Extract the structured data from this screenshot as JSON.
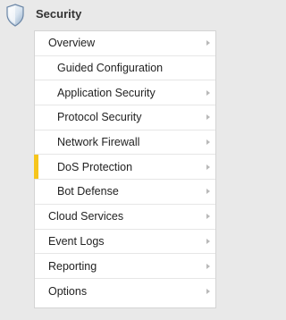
{
  "header": {
    "title": "Security",
    "icon": "shield-icon"
  },
  "menu": {
    "items": [
      {
        "label": "Overview",
        "level": 1,
        "has_submenu": true
      },
      {
        "label": "Guided Configuration",
        "level": 2,
        "has_submenu": false
      },
      {
        "label": "Application Security",
        "level": 2,
        "has_submenu": true
      },
      {
        "label": "Protocol Security",
        "level": 2,
        "has_submenu": true
      },
      {
        "label": "Network Firewall",
        "level": 2,
        "has_submenu": true
      },
      {
        "label": "DoS Protection",
        "level": 2,
        "has_submenu": true,
        "active": true
      },
      {
        "label": "Bot Defense",
        "level": 2,
        "has_submenu": true
      },
      {
        "label": "Cloud Services",
        "level": 1,
        "has_submenu": true
      },
      {
        "label": "Event Logs",
        "level": 1,
        "has_submenu": true
      },
      {
        "label": "Reporting",
        "level": 1,
        "has_submenu": true
      },
      {
        "label": "Options",
        "level": 1,
        "has_submenu": true
      }
    ],
    "active_color": "#f6c51c"
  }
}
